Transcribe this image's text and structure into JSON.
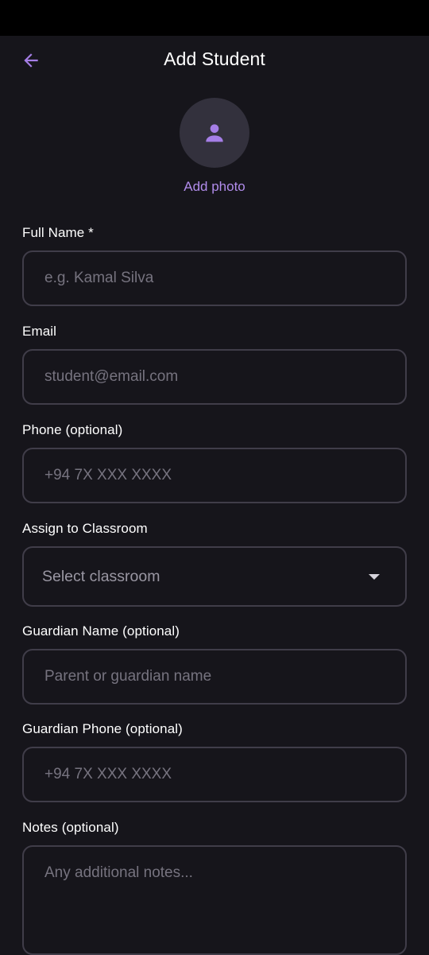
{
  "header": {
    "title": "Add Student",
    "back_icon": "arrow-left-icon"
  },
  "photo": {
    "icon": "person-icon",
    "label": "Add photo"
  },
  "colors": {
    "background": "#16151b",
    "accent": "#a57ee6",
    "field_border": "#403d49",
    "avatar_bg": "#33313d",
    "placeholder": "#76737f"
  },
  "form": {
    "full_name": {
      "label": "Full Name *",
      "placeholder": "e.g. Kamal Silva",
      "value": ""
    },
    "email": {
      "label": "Email",
      "placeholder": "student@email.com",
      "value": ""
    },
    "phone": {
      "label": "Phone (optional)",
      "placeholder": "+94 7X XXX XXXX",
      "value": ""
    },
    "classroom": {
      "label": "Assign to Classroom",
      "placeholder": "Select classroom",
      "icon": "dropdown-arrow-icon"
    },
    "guardian_name": {
      "label": "Guardian Name (optional)",
      "placeholder": "Parent or guardian name",
      "value": ""
    },
    "guardian_phone": {
      "label": "Guardian Phone (optional)",
      "placeholder": "+94 7X XXX XXXX",
      "value": ""
    },
    "notes": {
      "label": "Notes (optional)",
      "placeholder": "Any additional notes...",
      "value": ""
    }
  }
}
